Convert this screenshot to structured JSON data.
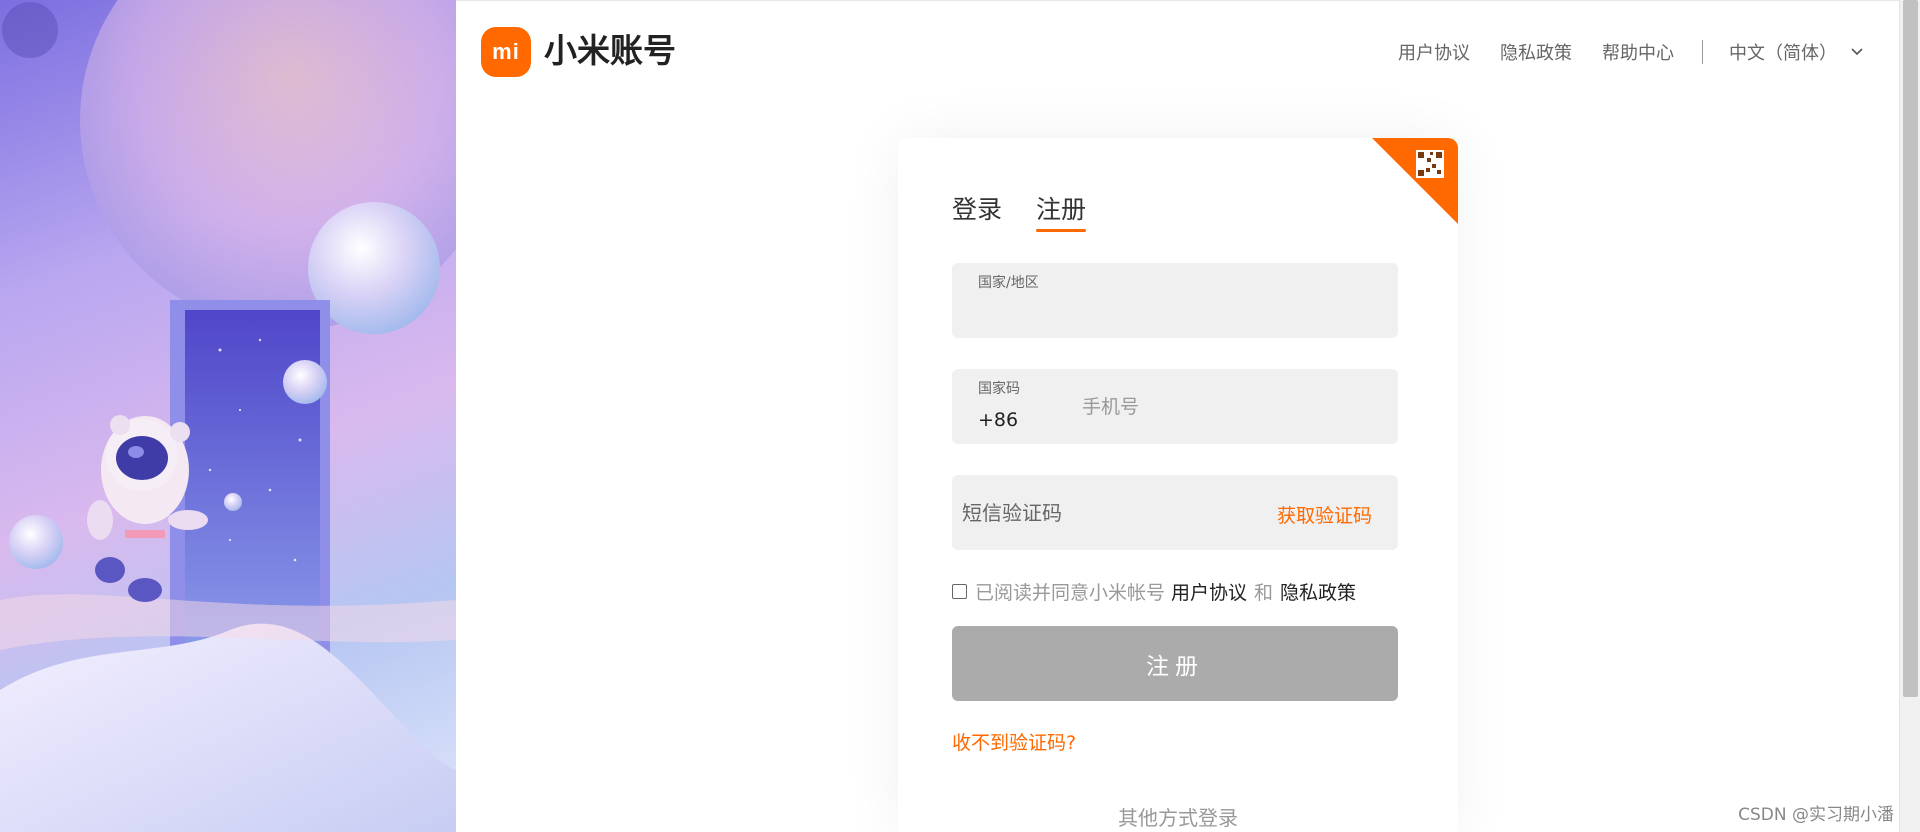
{
  "header": {
    "logo_mark": "mi",
    "logo_text": "小米账号",
    "nav": [
      {
        "label": "用户协议"
      },
      {
        "label": "隐私政策"
      },
      {
        "label": "帮助中心"
      }
    ],
    "language": "中文（简体）",
    "language_icon": "chevron-down-icon"
  },
  "card": {
    "tabs": [
      {
        "label": "登录",
        "active": false
      },
      {
        "label": "注册",
        "active": true
      }
    ],
    "region_label": "国家/地区",
    "region_value": "",
    "country_code_label": "国家码",
    "country_code_value": "+86",
    "phone_placeholder": "手机号",
    "sms_placeholder": "短信验证码",
    "get_code_label": "获取验证码",
    "agree_prefix": "已阅读并同意小米帐号",
    "agree_link1": "用户协议",
    "agree_and": "和",
    "agree_link2": "隐私政策",
    "register_button": "注册",
    "no_code_link": "收不到验证码?",
    "other_login": "其他方式登录"
  },
  "watermark": "CSDN @实习期小潘",
  "colors": {
    "accent": "#ff6900",
    "button_disabled": "#ababab",
    "field_bg": "#f0f0f0"
  }
}
